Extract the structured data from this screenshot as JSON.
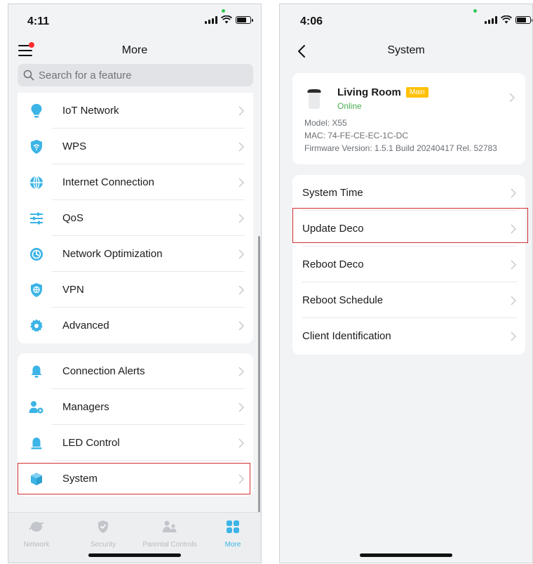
{
  "left_screen": {
    "status_time": "4:11",
    "title": "More",
    "search_placeholder": "Search for a feature",
    "group1": [
      {
        "label": "IoT Network",
        "icon": "bulb-icon"
      },
      {
        "label": "WPS",
        "icon": "wps-icon"
      },
      {
        "label": "Internet Connection",
        "icon": "globe-icon"
      },
      {
        "label": "QoS",
        "icon": "sliders-icon"
      },
      {
        "label": "Network Optimization",
        "icon": "optimization-icon"
      },
      {
        "label": "VPN",
        "icon": "vpn-shield-icon"
      },
      {
        "label": "Advanced",
        "icon": "gear-icon"
      }
    ],
    "group2": [
      {
        "label": "Connection Alerts",
        "icon": "bell-icon"
      },
      {
        "label": "Managers",
        "icon": "managers-icon"
      },
      {
        "label": "LED Control",
        "icon": "led-icon"
      },
      {
        "label": "System",
        "icon": "cube-icon"
      }
    ],
    "tabs": [
      {
        "label": "Network",
        "icon": "network-tab-icon",
        "active": false
      },
      {
        "label": "Security",
        "icon": "security-tab-icon",
        "active": false
      },
      {
        "label": "Parental Controls",
        "icon": "parental-tab-icon",
        "active": false
      },
      {
        "label": "More",
        "icon": "more-tab-icon",
        "active": true
      }
    ]
  },
  "right_screen": {
    "status_time": "4:06",
    "title": "System",
    "device": {
      "name": "Living Room",
      "tag": "Main",
      "status": "Online",
      "model": "Model: X55",
      "mac": "MAC: 74-FE-CE-EC-1C-DC",
      "firmware": "Firmware Version: 1.5.1 Build 20240417 Rel. 52783"
    },
    "items": [
      {
        "label": "System Time"
      },
      {
        "label": "Update Deco"
      },
      {
        "label": "Reboot Deco"
      },
      {
        "label": "Reboot Schedule"
      },
      {
        "label": "Client Identification"
      }
    ]
  },
  "colors": {
    "accent": "#3cb4e6",
    "highlight": "#d32f2f",
    "online": "#4caf50",
    "tag": "#ffc107",
    "badge": "#ff2d2d"
  }
}
